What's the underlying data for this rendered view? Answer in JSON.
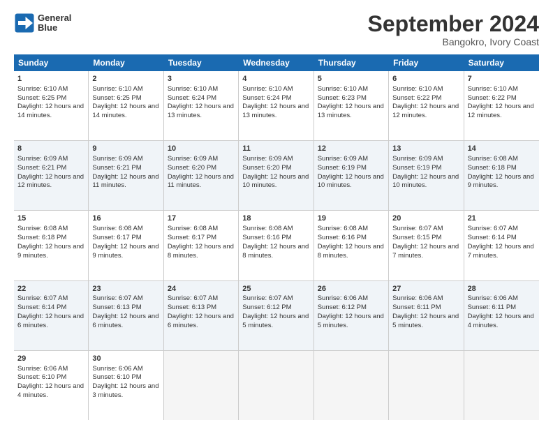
{
  "logo": {
    "line1": "General",
    "line2": "Blue"
  },
  "title": "September 2024",
  "subtitle": "Bangokro, Ivory Coast",
  "days": [
    "Sunday",
    "Monday",
    "Tuesday",
    "Wednesday",
    "Thursday",
    "Friday",
    "Saturday"
  ],
  "weeks": [
    [
      {
        "day": 1,
        "sunrise": "6:10 AM",
        "sunset": "6:25 PM",
        "daylight": "12 hours and 14 minutes."
      },
      {
        "day": 2,
        "sunrise": "6:10 AM",
        "sunset": "6:25 PM",
        "daylight": "12 hours and 14 minutes."
      },
      {
        "day": 3,
        "sunrise": "6:10 AM",
        "sunset": "6:24 PM",
        "daylight": "12 hours and 13 minutes."
      },
      {
        "day": 4,
        "sunrise": "6:10 AM",
        "sunset": "6:24 PM",
        "daylight": "12 hours and 13 minutes."
      },
      {
        "day": 5,
        "sunrise": "6:10 AM",
        "sunset": "6:23 PM",
        "daylight": "12 hours and 13 minutes."
      },
      {
        "day": 6,
        "sunrise": "6:10 AM",
        "sunset": "6:22 PM",
        "daylight": "12 hours and 12 minutes."
      },
      {
        "day": 7,
        "sunrise": "6:10 AM",
        "sunset": "6:22 PM",
        "daylight": "12 hours and 12 minutes."
      }
    ],
    [
      {
        "day": 8,
        "sunrise": "6:09 AM",
        "sunset": "6:21 PM",
        "daylight": "12 hours and 12 minutes."
      },
      {
        "day": 9,
        "sunrise": "6:09 AM",
        "sunset": "6:21 PM",
        "daylight": "12 hours and 11 minutes."
      },
      {
        "day": 10,
        "sunrise": "6:09 AM",
        "sunset": "6:20 PM",
        "daylight": "12 hours and 11 minutes."
      },
      {
        "day": 11,
        "sunrise": "6:09 AM",
        "sunset": "6:20 PM",
        "daylight": "12 hours and 10 minutes."
      },
      {
        "day": 12,
        "sunrise": "6:09 AM",
        "sunset": "6:19 PM",
        "daylight": "12 hours and 10 minutes."
      },
      {
        "day": 13,
        "sunrise": "6:09 AM",
        "sunset": "6:19 PM",
        "daylight": "12 hours and 10 minutes."
      },
      {
        "day": 14,
        "sunrise": "6:08 AM",
        "sunset": "6:18 PM",
        "daylight": "12 hours and 9 minutes."
      }
    ],
    [
      {
        "day": 15,
        "sunrise": "6:08 AM",
        "sunset": "6:18 PM",
        "daylight": "12 hours and 9 minutes."
      },
      {
        "day": 16,
        "sunrise": "6:08 AM",
        "sunset": "6:17 PM",
        "daylight": "12 hours and 9 minutes."
      },
      {
        "day": 17,
        "sunrise": "6:08 AM",
        "sunset": "6:17 PM",
        "daylight": "12 hours and 8 minutes."
      },
      {
        "day": 18,
        "sunrise": "6:08 AM",
        "sunset": "6:16 PM",
        "daylight": "12 hours and 8 minutes."
      },
      {
        "day": 19,
        "sunrise": "6:08 AM",
        "sunset": "6:16 PM",
        "daylight": "12 hours and 8 minutes."
      },
      {
        "day": 20,
        "sunrise": "6:07 AM",
        "sunset": "6:15 PM",
        "daylight": "12 hours and 7 minutes."
      },
      {
        "day": 21,
        "sunrise": "6:07 AM",
        "sunset": "6:14 PM",
        "daylight": "12 hours and 7 minutes."
      }
    ],
    [
      {
        "day": 22,
        "sunrise": "6:07 AM",
        "sunset": "6:14 PM",
        "daylight": "12 hours and 6 minutes."
      },
      {
        "day": 23,
        "sunrise": "6:07 AM",
        "sunset": "6:13 PM",
        "daylight": "12 hours and 6 minutes."
      },
      {
        "day": 24,
        "sunrise": "6:07 AM",
        "sunset": "6:13 PM",
        "daylight": "12 hours and 6 minutes."
      },
      {
        "day": 25,
        "sunrise": "6:07 AM",
        "sunset": "6:12 PM",
        "daylight": "12 hours and 5 minutes."
      },
      {
        "day": 26,
        "sunrise": "6:06 AM",
        "sunset": "6:12 PM",
        "daylight": "12 hours and 5 minutes."
      },
      {
        "day": 27,
        "sunrise": "6:06 AM",
        "sunset": "6:11 PM",
        "daylight": "12 hours and 5 minutes."
      },
      {
        "day": 28,
        "sunrise": "6:06 AM",
        "sunset": "6:11 PM",
        "daylight": "12 hours and 4 minutes."
      }
    ],
    [
      {
        "day": 29,
        "sunrise": "6:06 AM",
        "sunset": "6:10 PM",
        "daylight": "12 hours and 4 minutes."
      },
      {
        "day": 30,
        "sunrise": "6:06 AM",
        "sunset": "6:10 PM",
        "daylight": "12 hours and 3 minutes."
      },
      null,
      null,
      null,
      null,
      null
    ]
  ]
}
